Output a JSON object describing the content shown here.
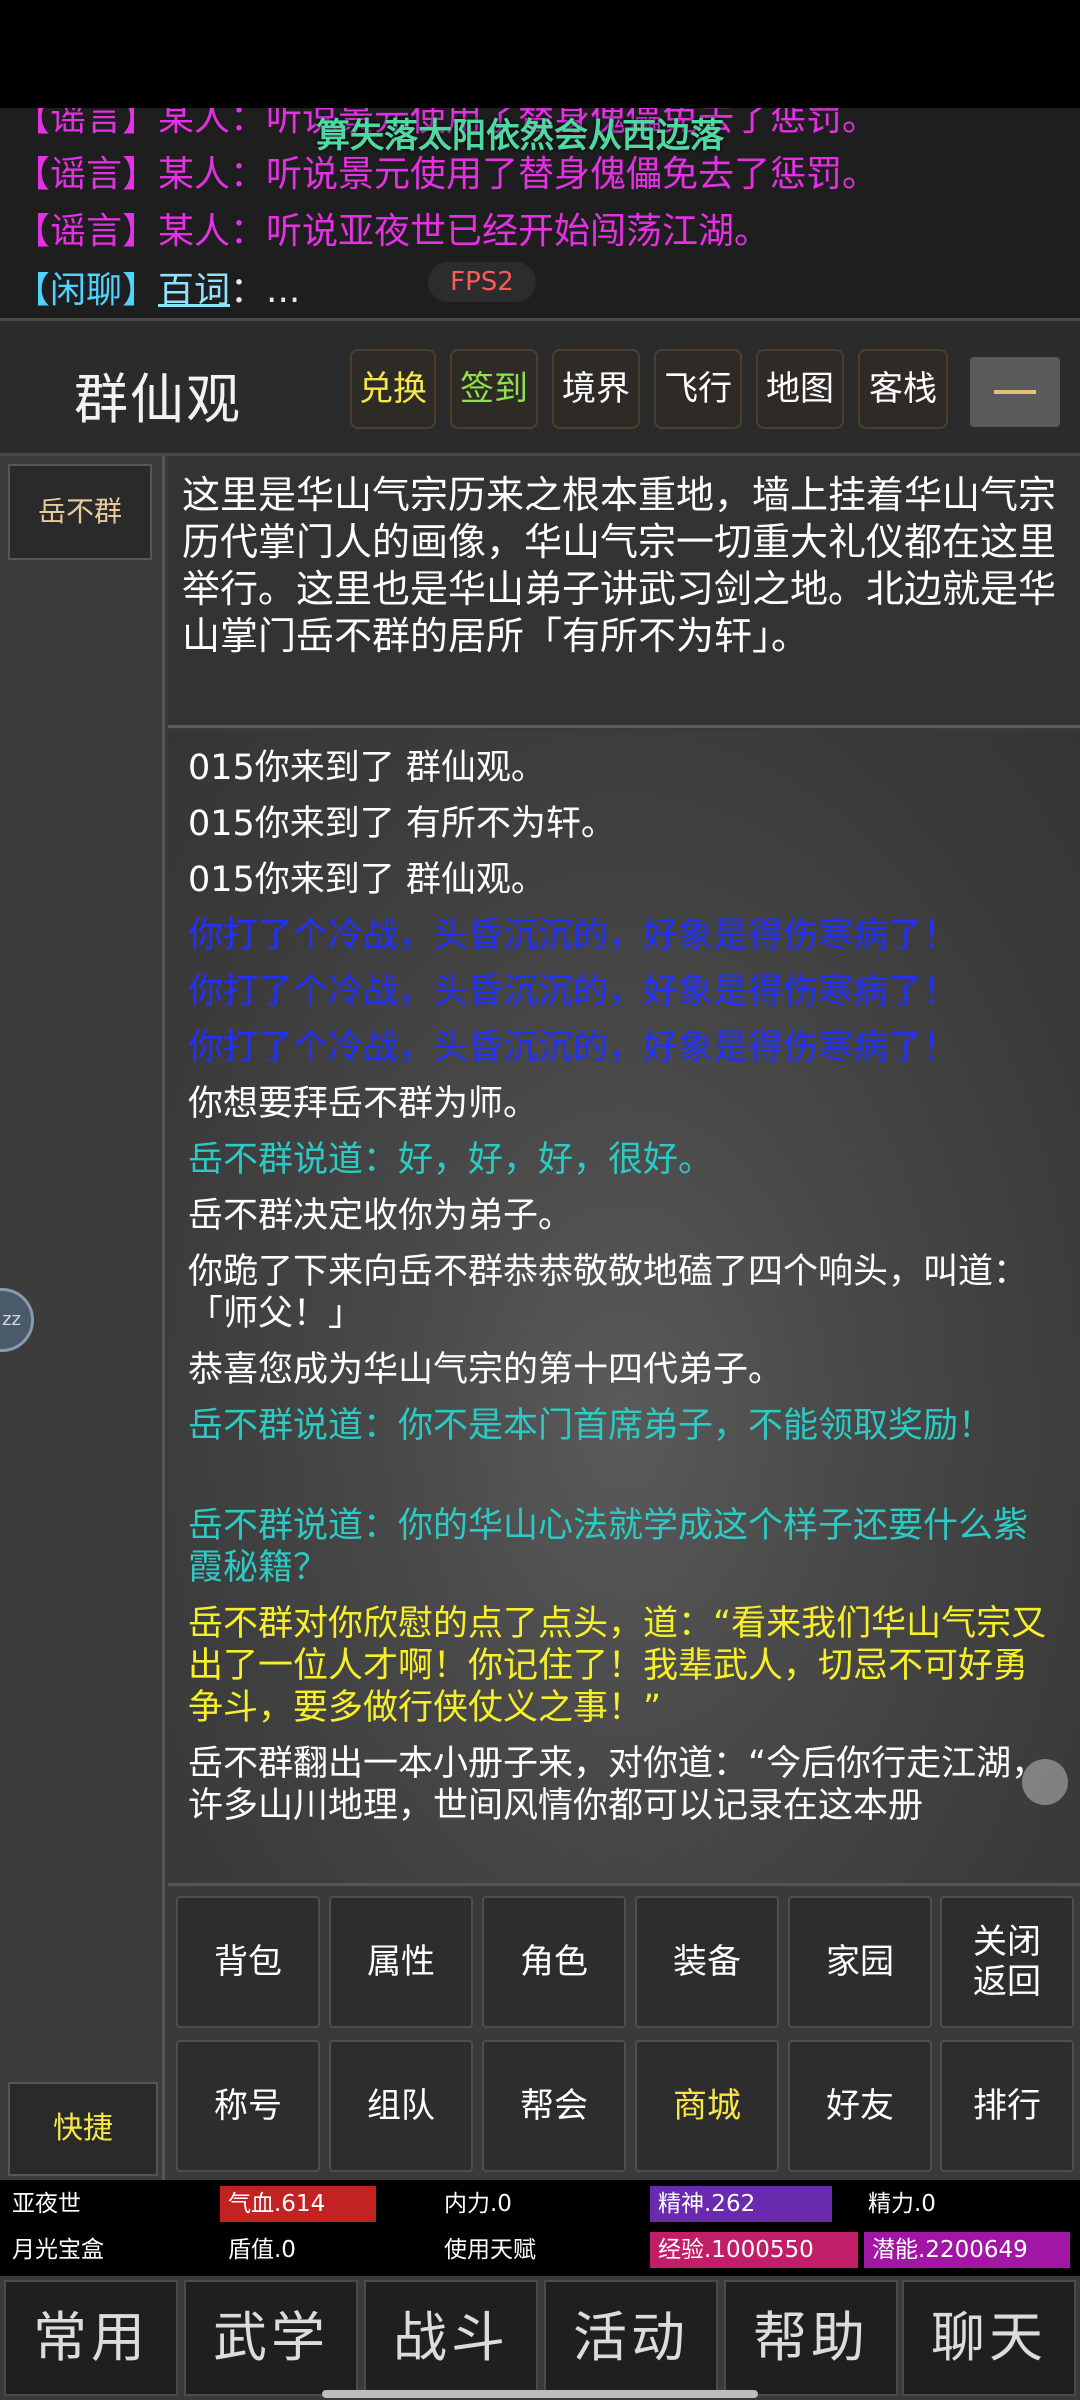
{
  "chat": {
    "line0": "【谣言】某人：听说景元使用了替身傀儡免去了惩罚。",
    "line1": "【谣言】某人：听说亚夜世已经开始闯荡江湖。",
    "idle_tag": "【闲聊】",
    "idle_name": "百词",
    "idle_text": "：...",
    "marquee": "算失落太阳依然会从西边落",
    "fps": "FPS2"
  },
  "header": {
    "room_title": "群仙观",
    "buttons": [
      {
        "label": "兑换",
        "color": "#f7e64a"
      },
      {
        "label": "签到",
        "color": "#8ee14a"
      },
      {
        "label": "境界",
        "color": "#ffffff"
      },
      {
        "label": "飞行",
        "color": "#ffffff"
      },
      {
        "label": "地图",
        "color": "#ffffff"
      },
      {
        "label": "客栈",
        "color": "#ffffff"
      }
    ]
  },
  "left": {
    "npc": "岳不群",
    "zz": "zz",
    "quick": "快捷"
  },
  "description": "这里是华山气宗历来之根本重地，墙上挂着华山气宗历代掌门人的画像，华山气宗一切重大礼仪都在这里举行。这里也是华山弟子讲武习剑之地。北边就是华山掌门岳不群的居所「有所不为轩」。",
  "log": [
    {
      "text": "015你来到了 群仙观。",
      "style": "white"
    },
    {
      "text": "015你来到了 有所不为轩。",
      "style": "white"
    },
    {
      "text": "015你来到了 群仙观。",
      "style": "white"
    },
    {
      "text": "你打了个冷战，头昏沉沉的，好象是得伤寒病了！",
      "style": "blue"
    },
    {
      "text": "你打了个冷战，头昏沉沉的，好象是得伤寒病了！",
      "style": "blue"
    },
    {
      "text": "你打了个冷战，头昏沉沉的，好象是得伤寒病了！",
      "style": "blue"
    },
    {
      "text": "你想要拜岳不群为师。",
      "style": "white"
    },
    {
      "text": "岳不群说道：好，好，好，很好。",
      "style": "cyan"
    },
    {
      "text": "岳不群决定收你为弟子。",
      "style": "white"
    },
    {
      "text": "你跪了下来向岳不群恭恭敬敬地磕了四个响头，叫道：「师父！」",
      "style": "white"
    },
    {
      "text": "恭喜您成为华山气宗的第十四代弟子。",
      "style": "white"
    },
    {
      "text": "岳不群说道：你不是本门首席弟子，不能领取奖励！",
      "style": "cyan"
    },
    {
      "text": "",
      "style": "gap"
    },
    {
      "text": "岳不群说道：你的华山心法就学成这个样子还要什么紫霞秘籍？",
      "style": "cyan"
    },
    {
      "text": "岳不群对你欣慰的点了点头，道：“看来我们华山气宗又出了一位人才啊！你记住了！我辈武人，切忌不可好勇争斗，要多做行侠仗义之事！”",
      "style": "yellow"
    },
    {
      "text": "岳不群翻出一本小册子来，对你道：“今后你行走江湖，许多山川地理，世间风情你都可以记录在这本册",
      "style": "white"
    }
  ],
  "actions": {
    "row1": [
      "背包",
      "属性",
      "角色",
      "装备",
      "家园",
      "关闭\n返回"
    ],
    "row2": [
      "称号",
      "组队",
      "帮会",
      "商城",
      "好友",
      "排行"
    ],
    "highlight": "商城"
  },
  "stats": {
    "name": "亚夜世",
    "item": "月光宝盒",
    "hp": "气血.614",
    "neili": "内力.0",
    "jingshen": "精神.262",
    "jingli": "精力.0",
    "dunzhi": "盾值.0",
    "talent": "使用天赋",
    "exp": "经验.1000550",
    "potential": "潜能.2200649"
  },
  "nav": [
    "常用",
    "武学",
    "战斗",
    "活动",
    "帮助",
    "聊天"
  ]
}
